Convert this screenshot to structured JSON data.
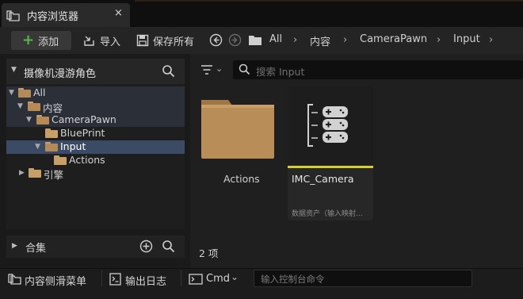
{
  "tab": {
    "title": "内容浏览器",
    "close": "×"
  },
  "toolbar": {
    "add_label": "添加",
    "import_label": "导入",
    "save_all_label": "保存所有",
    "breadcrumb": [
      "All",
      "内容",
      "CameraPawn",
      "Input"
    ]
  },
  "left_panel": {
    "collection_title": "摄像机漫游角色",
    "tree": [
      {
        "label": "All"
      },
      {
        "label": "内容"
      },
      {
        "label": "CameraPawn"
      },
      {
        "label": "BluePrint"
      },
      {
        "label": "Input"
      },
      {
        "label": "Actions"
      },
      {
        "label": "引擎"
      }
    ],
    "sets_label": "合集"
  },
  "right_panel": {
    "search_placeholder": "搜索 Input",
    "assets": [
      {
        "name": "Actions",
        "kind": "folder"
      },
      {
        "name": "IMC_Camera",
        "type": "数据资产（输入映射..."
      }
    ],
    "item_count": "2 项"
  },
  "bottom_bar": {
    "content_drawer": "内容侧滑菜单",
    "output_log": "输出日志",
    "cmd": "Cmd",
    "console_placeholder": "输入控制台命令"
  },
  "colors": {
    "accent_add": "#58b948",
    "selection": "#3b4b66",
    "asset_strip": "#d7cd2e",
    "folder": "#c79f68"
  }
}
